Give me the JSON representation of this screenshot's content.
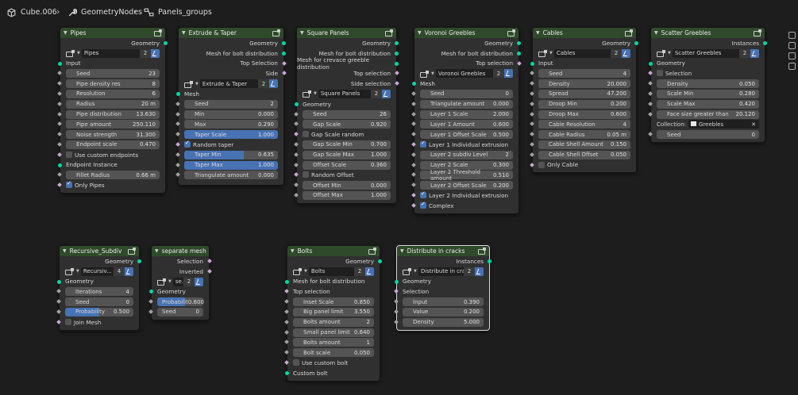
{
  "breadcrumb": {
    "object": "Cube.006",
    "modifier": "GeometryNodes",
    "group": "Panels_groups"
  },
  "nodes": {
    "pipes": {
      "title": "Pipes",
      "out_geometry": "Geometry",
      "group": "Pipes",
      "users": "2",
      "input": "Input",
      "seed": {
        "label": "Seed",
        "value": "23"
      },
      "density": {
        "label": "Pipe density res",
        "value": "8"
      },
      "resolution": {
        "label": "Resolution",
        "value": "6"
      },
      "radius": {
        "label": "Radius",
        "value": "20 m"
      },
      "distribution": {
        "label": "Pipe distribution",
        "value": "13.630"
      },
      "amount": {
        "label": "Pipe amount",
        "value": "250.110"
      },
      "noise": {
        "label": "Noise strength",
        "value": "31.300"
      },
      "endpoint_scale": {
        "label": "Endpoint scale",
        "value": "0.470"
      },
      "use_custom": "Use custom endpoints",
      "endpoint_instance": "Endpoint Instance",
      "fillet": {
        "label": "Fillet Radius",
        "value": "0.66 m"
      },
      "only_pipes": "Only Pipes"
    },
    "extrude": {
      "title": "Extrude & Taper",
      "out_geometry": "Geometry",
      "out_mesh_bolt": "Mesh for bolt distribution",
      "out_top": "Top Selection",
      "out_side": "Side",
      "group": "Extrude & Taper",
      "users": "2",
      "mesh": "Mesh",
      "seed": {
        "label": "Seed",
        "value": "2"
      },
      "min": {
        "label": "Min",
        "value": "0.000"
      },
      "max": {
        "label": "Max",
        "value": "0.290"
      },
      "taper_scale": {
        "label": "Taper Scale",
        "value": "1.000"
      },
      "random_taper": "Random taper",
      "taper_min": {
        "label": "Taper Min",
        "value": "0.635"
      },
      "taper_max": {
        "label": "Taper Max",
        "value": "1.000"
      },
      "triangulate": {
        "label": "Triangulate amount",
        "value": "0.000"
      }
    },
    "square": {
      "title": "Square Panels",
      "out_geometry": "Geometry",
      "out_mesh_bolt": "Mesh for bolt distribution",
      "out_crevace": "Mesh for crevace greeble distribution",
      "out_top": "Top selection",
      "out_side": "Side selection",
      "group": "Square Panels",
      "users": "2",
      "geometry": "Geometry",
      "seed": {
        "label": "Seed",
        "value": "26"
      },
      "gap_scale": {
        "label": "Gap Scale",
        "value": "0.920"
      },
      "gap_random": "Gap Scale random",
      "gap_min": {
        "label": "Gap Scale Min",
        "value": "0.700"
      },
      "gap_max": {
        "label": "Gap Scale Max",
        "value": "1.000"
      },
      "offset_scale": {
        "label": "Offset Scale",
        "value": "0.360"
      },
      "random_offset": "Random Offset",
      "offset_min": {
        "label": "Offset Min",
        "value": "0.000"
      },
      "offset_max": {
        "label": "Offset Max",
        "value": "1.000"
      }
    },
    "voronoi": {
      "title": "Voronoi Greebles",
      "out_geometry": "Geometry",
      "out_mesh_bolt": "Mesh for bolt distribution",
      "out_top": "Top selection",
      "group": "Voronoi Greebles",
      "users": "2",
      "mesh": "Mesh",
      "seed": {
        "label": "Seed",
        "value": "0"
      },
      "triangulate": {
        "label": "Triangulate amount",
        "value": "0.000"
      },
      "l1_scale": {
        "label": "Layer 1 Scale",
        "value": "2.000"
      },
      "l1_amount": {
        "label": "Layer 1 Amount",
        "value": "0.600"
      },
      "l1_offset": {
        "label": "Layer 1 Offset Scale",
        "value": "0.500"
      },
      "l1_indiv": "Layer 1 Individual extrusion",
      "l2_subdiv": {
        "label": "Layer 2 subdiv Level",
        "value": "2"
      },
      "l2_scale": {
        "label": "Layer 2 Scale",
        "value": "0.300"
      },
      "l2_threshold": {
        "label": "Layer 2 Threshold amount",
        "value": "0.510"
      },
      "l2_offset": {
        "label": "Layer 2 Offset Scale",
        "value": "0.200"
      },
      "l2_indiv": "Layer 2 Individual extrusion",
      "complex": "Complex"
    },
    "cables": {
      "title": "Cables",
      "out_geometry": "Geometry",
      "group": "Cables",
      "users": "2",
      "input": "Input",
      "seed": {
        "label": "Seed",
        "value": "4"
      },
      "density": {
        "label": "Density",
        "value": "20.000"
      },
      "spread": {
        "label": "Spread",
        "value": "47.200"
      },
      "droop_min": {
        "label": "Droop Min",
        "value": "0.200"
      },
      "droop_max": {
        "label": "Droop Max",
        "value": "0.600"
      },
      "resolution": {
        "label": "Cable Resolution",
        "value": "4"
      },
      "radius": {
        "label": "Cable Radius",
        "value": "0.05 m"
      },
      "shell_amount": {
        "label": "Cable Shell Amount",
        "value": "0.150"
      },
      "shell_offset": {
        "label": "Cable Shell Offset",
        "value": "0.050"
      },
      "only_cable": "Only Cable"
    },
    "scatter": {
      "title": "Scatter Greebles",
      "out_instances": "Instances",
      "group": "Scatter Greebles",
      "users": "2",
      "geometry": "Geometry",
      "selection": "Selection",
      "density": {
        "label": "Density",
        "value": "0.050"
      },
      "scale_min": {
        "label": "Scale Min",
        "value": "0.280"
      },
      "scale_max": {
        "label": "Scale Max",
        "value": "0.420"
      },
      "face_size": {
        "label": "Face size greater than",
        "value": "20.120"
      },
      "collection_label": "Collection:",
      "collection": "Greebles",
      "seed": {
        "label": "Seed",
        "value": "0"
      }
    },
    "recursive": {
      "title": "Recursive_Subdiv",
      "out_geometry": "Geometry",
      "group": "Recursiv...",
      "users": "4",
      "geometry": "Geometry",
      "iterations": {
        "label": "Iterations",
        "value": "4"
      },
      "seed": {
        "label": "Seed",
        "value": "0"
      },
      "probability": {
        "label": "Probability",
        "value": "0.500"
      },
      "join": "Join Mesh"
    },
    "separate": {
      "title": "separate mesh",
      "out_selection": "Selection",
      "out_inverted": "Inverted",
      "group": "se...",
      "users": "2",
      "geometry": "Geometry",
      "probability": {
        "label": "Probabilit",
        "value": "0.600"
      },
      "seed": {
        "label": "Seed",
        "value": "0"
      }
    },
    "bolts": {
      "title": "Bolts",
      "out_geometry": "Geometry",
      "group": "Bolts",
      "users": "2",
      "mesh_bolt": "Mesh for bolt distribution",
      "top": "Top selection",
      "inset": {
        "label": "Inset Scale",
        "value": "0.850"
      },
      "big_limit": {
        "label": "Big panel limit",
        "value": "3.550"
      },
      "bolts_amount": {
        "label": "Bolts amount",
        "value": "2"
      },
      "small_limit": {
        "label": "Small panel limit",
        "value": "0.640"
      },
      "bolts_amount2": {
        "label": "Bolts amount",
        "value": "1"
      },
      "bolt_scale": {
        "label": "Bolt scale",
        "value": "0.050"
      },
      "use_custom": "Use custom bolt",
      "custom_bolt": "Custom bolt"
    },
    "distribute": {
      "title": "Distribute in cracks",
      "out_instances": "Instances",
      "group": "Distribute in cracks",
      "users": "2",
      "geometry": "Geometry",
      "selection": "Selection",
      "input": {
        "label": "Input",
        "value": "0.390"
      },
      "value": {
        "label": "Value",
        "value": "0.200"
      },
      "density": {
        "label": "Density",
        "value": "5.000"
      }
    }
  },
  "colors": {
    "header_green": "#2f4a2a",
    "field_blue": "#4772b3",
    "socket_geometry": "#00d6a3",
    "socket_float": "#a1a1a1",
    "socket_bool": "#cca6d6"
  },
  "slider_fills": {
    "extrude_taper_scale": 1.0,
    "extrude_taper_min": 0.635,
    "extrude_taper_max": 1.0,
    "recursive_probability": 0.5,
    "separate_probability": 0.6
  }
}
